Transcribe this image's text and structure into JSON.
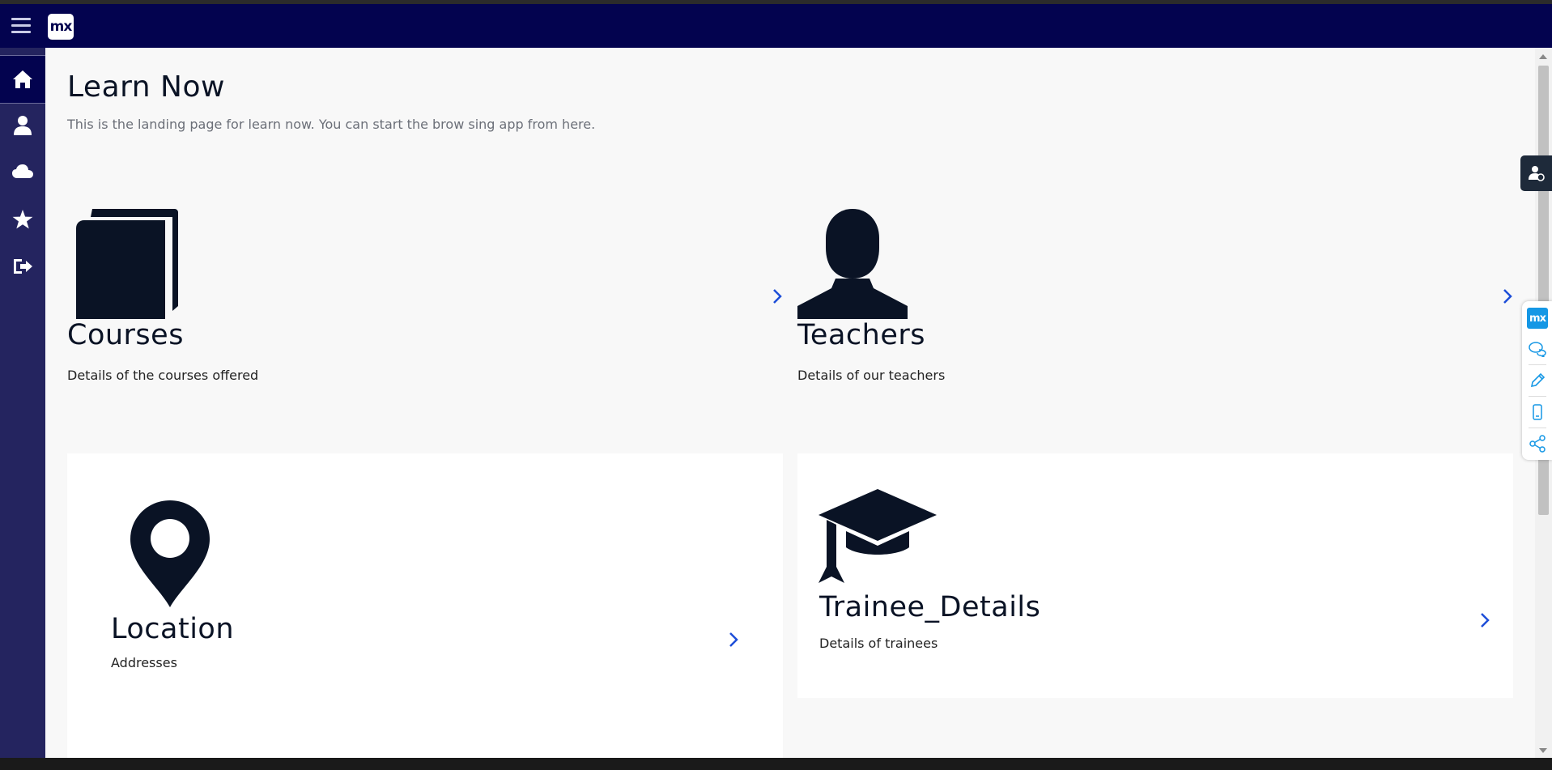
{
  "app": {
    "logo_text": "mx"
  },
  "topbar": {
    "background": "#03034f"
  },
  "sidebar": {
    "items": [
      {
        "name": "home",
        "icon": "home-icon",
        "active": true
      },
      {
        "name": "profile",
        "icon": "user-icon",
        "active": false
      },
      {
        "name": "cloud",
        "icon": "cloud-icon",
        "active": false
      },
      {
        "name": "favorites",
        "icon": "star-icon",
        "active": false
      },
      {
        "name": "logout",
        "icon": "sign-out-icon",
        "active": false
      }
    ]
  },
  "main": {
    "title": "Learn Now",
    "subtitle": "This is the landing page for learn now. You can start the brow sing app from here.",
    "tiles": [
      {
        "title": "Courses",
        "description": "Details of the courses offered",
        "icon": "book-icon"
      },
      {
        "title": "Teachers",
        "description": "Details of our teachers",
        "icon": "person-icon"
      },
      {
        "title": "Location",
        "description": "Addresses",
        "icon": "map-pin-icon"
      },
      {
        "title": "Trainee_Details",
        "description": "Details of trainees",
        "icon": "graduation-cap-icon"
      }
    ]
  },
  "mx_toolbar": {
    "logo_text": "mx",
    "items": [
      "feedback-icon",
      "edit-icon",
      "mobile-preview-icon",
      "share-icon"
    ]
  },
  "colors": {
    "accent": "#1d4ed8",
    "icon": "#0a1325",
    "mx_blue": "#1597e5"
  }
}
